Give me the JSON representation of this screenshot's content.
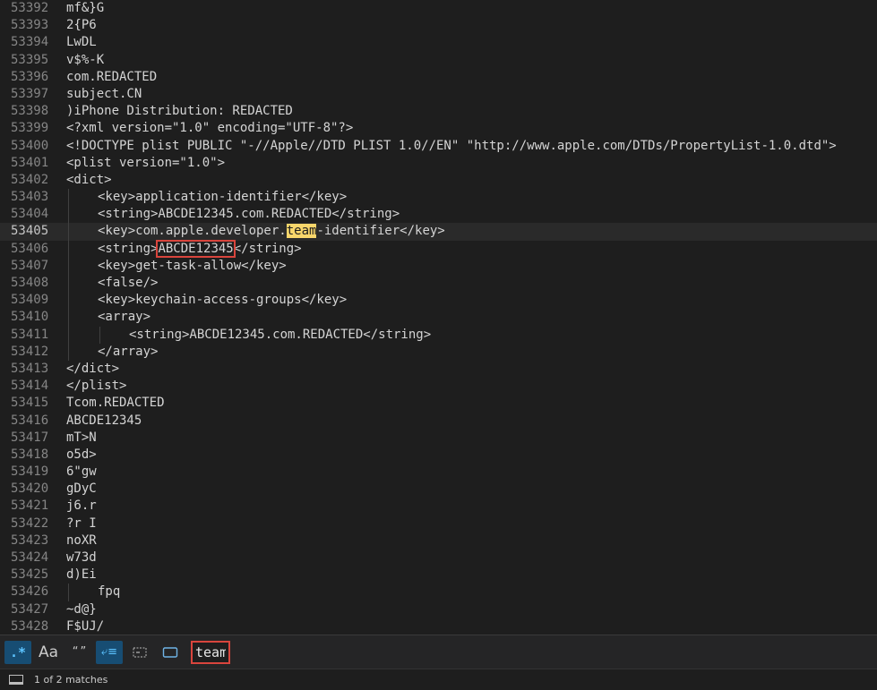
{
  "editor": {
    "current_line": "53405",
    "lines": [
      {
        "num": "53392",
        "indent": 0,
        "text": "mf&}G"
      },
      {
        "num": "53393",
        "indent": 0,
        "text": "2{P6"
      },
      {
        "num": "53394",
        "indent": 0,
        "text": "LwDL"
      },
      {
        "num": "53395",
        "indent": 0,
        "text": "v$%-K"
      },
      {
        "num": "53396",
        "indent": 0,
        "text": "com.REDACTED"
      },
      {
        "num": "53397",
        "indent": 0,
        "text": "subject.CN"
      },
      {
        "num": "53398",
        "indent": 0,
        "text": ")iPhone Distribution: REDACTED"
      },
      {
        "num": "53399",
        "indent": 0,
        "text": "<?xml version=\"1.0\" encoding=\"UTF-8\"?>"
      },
      {
        "num": "53400",
        "indent": 0,
        "text": "<!DOCTYPE plist PUBLIC \"-//Apple//DTD PLIST 1.0//EN\" \"http://www.apple.com/DTDs/PropertyList-1.0.dtd\">"
      },
      {
        "num": "53401",
        "indent": 0,
        "text": "<plist version=\"1.0\">"
      },
      {
        "num": "53402",
        "indent": 0,
        "text": "<dict>"
      },
      {
        "num": "53403",
        "indent": 1,
        "text": "<key>application-identifier</key>"
      },
      {
        "num": "53404",
        "indent": 1,
        "text": "<string>ABCDE12345.com.REDACTED</string>"
      },
      {
        "num": "53405",
        "indent": 1,
        "pre": "<key>com.apple.developer.",
        "match": "team",
        "post": "-identifier</key>"
      },
      {
        "num": "53406",
        "indent": 1,
        "pre": "<string>",
        "boxed": "ABCDE12345",
        "post": "</string>"
      },
      {
        "num": "53407",
        "indent": 1,
        "text": "<key>get-task-allow</key>"
      },
      {
        "num": "53408",
        "indent": 1,
        "text": "<false/>"
      },
      {
        "num": "53409",
        "indent": 1,
        "text": "<key>keychain-access-groups</key>"
      },
      {
        "num": "53410",
        "indent": 1,
        "text": "<array>"
      },
      {
        "num": "53411",
        "indent": 2,
        "text": "<string>ABCDE12345.com.REDACTED</string>"
      },
      {
        "num": "53412",
        "indent": 1,
        "text": "</array>"
      },
      {
        "num": "53413",
        "indent": 0,
        "text": "</dict>"
      },
      {
        "num": "53414",
        "indent": 0,
        "text": "</plist>"
      },
      {
        "num": "53415",
        "indent": 0,
        "text": "Tcom.REDACTED"
      },
      {
        "num": "53416",
        "indent": 0,
        "text": "ABCDE12345"
      },
      {
        "num": "53417",
        "indent": 0,
        "text": "mT>N"
      },
      {
        "num": "53418",
        "indent": 0,
        "text": "o5d>"
      },
      {
        "num": "53419",
        "indent": 0,
        "text": "6\"gw"
      },
      {
        "num": "53420",
        "indent": 0,
        "text": "gDyC"
      },
      {
        "num": "53421",
        "indent": 0,
        "text": "j6.r"
      },
      {
        "num": "53422",
        "indent": 0,
        "text": "?r I"
      },
      {
        "num": "53423",
        "indent": 0,
        "text": "noXR"
      },
      {
        "num": "53424",
        "indent": 0,
        "text": "w73d"
      },
      {
        "num": "53425",
        "indent": 0,
        "text": "d)Ei"
      },
      {
        "num": "53426",
        "indent": 1,
        "text": "fpq"
      },
      {
        "num": "53427",
        "indent": 0,
        "text": "~d@}"
      },
      {
        "num": "53428",
        "indent": 0,
        "text": "F$UJ/"
      }
    ]
  },
  "findbar": {
    "regex_label": ".*",
    "case_label": "Aa",
    "whole_word_label": "“ ”",
    "wrap_label": "⤶≡",
    "search_value": "team"
  },
  "status": {
    "matches_text": "1 of 2 matches"
  },
  "colors": {
    "match_highlight": "#f8d66b",
    "annotation_box": "#d9453d",
    "toggle_on": "#174d73"
  },
  "icons": [
    "regex-icon",
    "case-sensitive-icon",
    "whole-word-icon",
    "wrap-icon",
    "in-selection-icon",
    "highlight-matches-icon",
    "panel-icon"
  ]
}
